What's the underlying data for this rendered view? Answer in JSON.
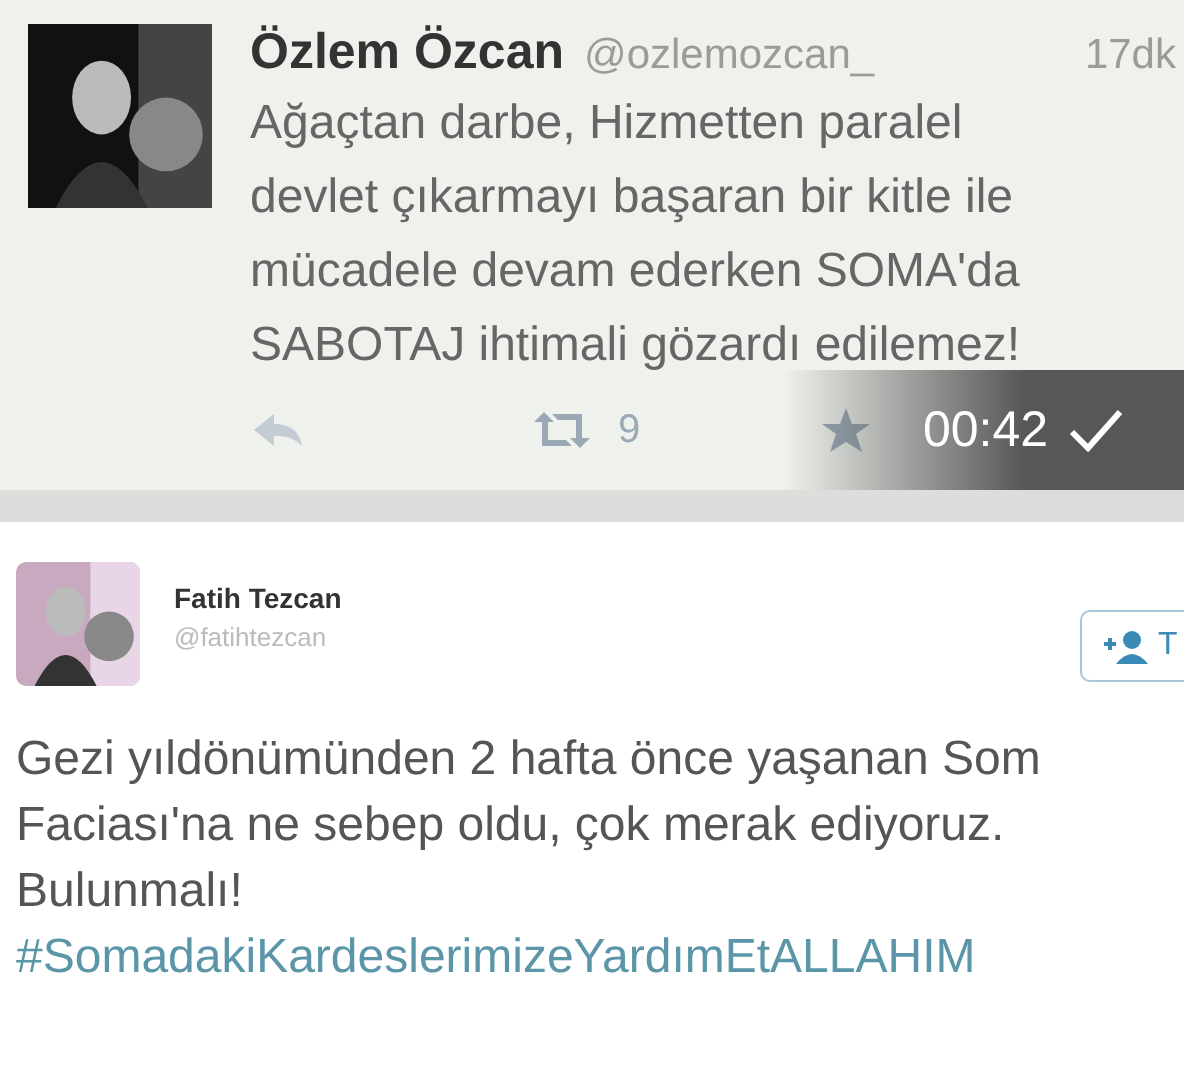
{
  "tweets": [
    {
      "name": "Özlem Özcan",
      "handle": "@ozlemozcan_",
      "time": "17dk",
      "body_lines": [
        "Ağaçtan darbe, Hizmetten paralel",
        "devlet çıkarmayı başaran bir kitle ile",
        "mücadele devam ederken SOMA'da",
        "SABOTAJ ihtimali gözardı edilemez!"
      ],
      "retweets": "9",
      "overlay": {
        "time": "00:42"
      }
    },
    {
      "name": "Fatih Tezcan",
      "handle": "@fatihtezcan",
      "follow_label": "T",
      "body_lines": [
        "Gezi yıldönümünden 2 hafta önce yaşanan Som",
        "Faciası'na ne sebep oldu, çok merak ediyoruz.",
        "Bulunmalı!"
      ],
      "hashtag": "#SomadakiKardeslerimizeYardımEtALLAHIM"
    }
  ]
}
